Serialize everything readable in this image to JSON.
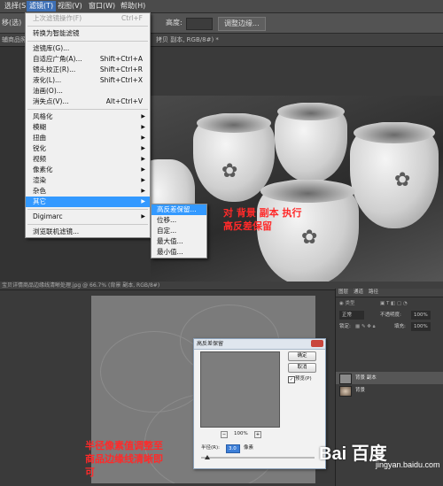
{
  "top": {
    "menubar": [
      "选择(S)",
      "滤镜(T)",
      "视图(V)",
      "窗口(W)",
      "帮助(H)"
    ],
    "options": {
      "left_label": "移(选)",
      "height_label": "高度:",
      "adjust_edge_button": "调整边缘..."
    },
    "tabs": {
      "left": "辅商品照",
      "right": "拷贝 副本, RGB/8#) *"
    },
    "filter_menu": [
      {
        "label": "上次滤镜操作(F)",
        "shortcut": "Ctrl+F",
        "disabled": true
      },
      {
        "sep": true
      },
      {
        "label": "转换为智能滤镜"
      },
      {
        "sep": true
      },
      {
        "label": "滤镜库(G)..."
      },
      {
        "label": "自适应广角(A)...",
        "shortcut": "Shift+Ctrl+A"
      },
      {
        "label": "镜头校正(R)...",
        "shortcut": "Shift+Ctrl+R"
      },
      {
        "label": "液化(L)...",
        "shortcut": "Shift+Ctrl+X"
      },
      {
        "label": "油画(O)..."
      },
      {
        "label": "消失点(V)...",
        "shortcut": "Alt+Ctrl+V"
      },
      {
        "sep": true
      },
      {
        "label": "风格化",
        "submenu": true
      },
      {
        "label": "模糊",
        "submenu": true
      },
      {
        "label": "扭曲",
        "submenu": true
      },
      {
        "label": "锐化",
        "submenu": true
      },
      {
        "label": "视频",
        "submenu": true
      },
      {
        "label": "像素化",
        "submenu": true
      },
      {
        "label": "渲染",
        "submenu": true
      },
      {
        "label": "杂色",
        "submenu": true
      },
      {
        "label": "其它",
        "submenu": true,
        "highlighted": true
      },
      {
        "sep": true
      },
      {
        "label": "Digimarc",
        "submenu": true
      },
      {
        "sep": true
      },
      {
        "label": "浏览联机滤镜..."
      }
    ],
    "other_submenu": [
      {
        "label": "高反差保留...",
        "highlighted": true
      },
      {
        "label": "位移..."
      },
      {
        "label": "自定..."
      },
      {
        "label": "最大值..."
      },
      {
        "label": "最小值..."
      }
    ],
    "annotation_line1": "对 背景 副本 执行",
    "annotation_line2": "高反差保留"
  },
  "bottom": {
    "doc_title": "宝贝详情商品边缘线清晰处理.jpg @ 66.7% (背景 副本, RGB/8#)",
    "dialog": {
      "title": "高反差保留",
      "ok_button": "确定",
      "cancel_button": "取消",
      "preview_checkbox": "预览(P)",
      "preview_checked": true,
      "zoom_value": "100%",
      "radius_label": "半径(R):",
      "radius_value": "3.0",
      "unit": "像素"
    },
    "layers_panel": {
      "tabs": [
        "图层",
        "通道",
        "路径"
      ],
      "blend_mode": "正常",
      "opacity_label": "不透明度:",
      "opacity_value": "100%",
      "fill_label": "填充:",
      "fill_value": "100%",
      "lock_label": "锁定:",
      "layers": [
        {
          "name": "背景 副本",
          "selected": true
        },
        {
          "name": "背景",
          "selected": false
        }
      ]
    },
    "annotation_line1": "半径像素值调整至",
    "annotation_line2": "商品边缘线清晰即",
    "annotation_line3": "可"
  },
  "watermark": {
    "logo": "Bai 百度",
    "sub": "jingyan.baidu.com"
  },
  "colors": {
    "highlight": "#3399ff",
    "annotation": "#ff2a2a"
  }
}
